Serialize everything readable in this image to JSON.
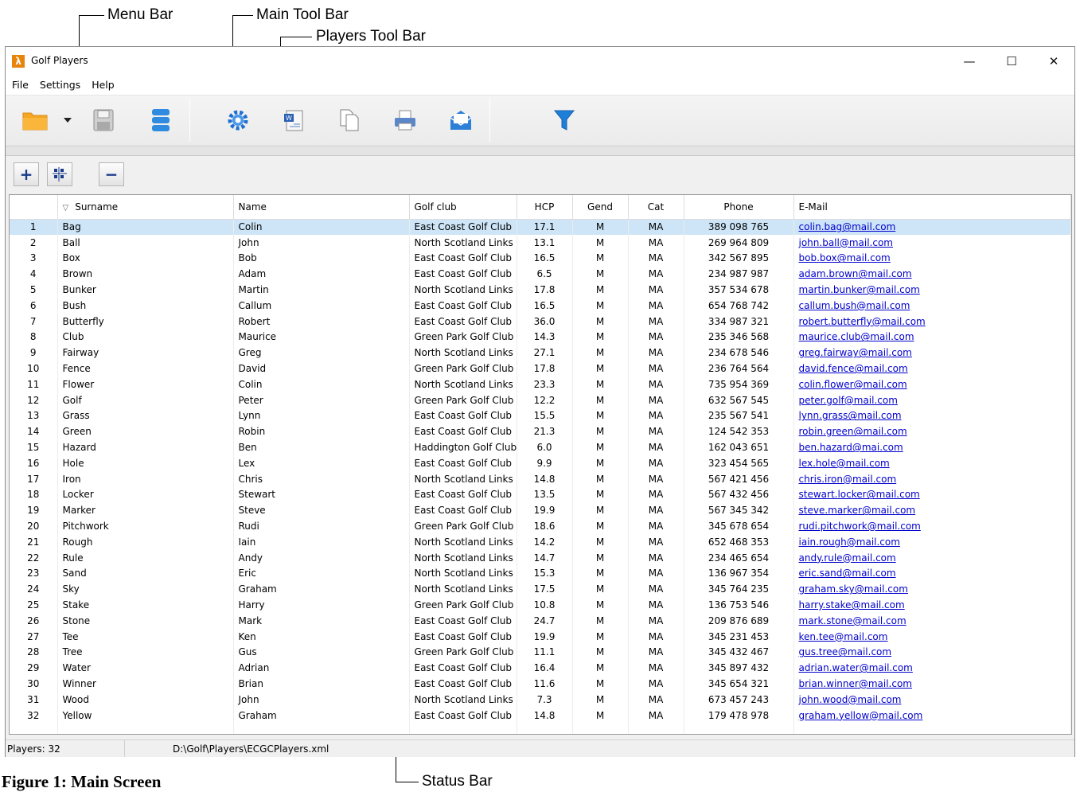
{
  "annotations": {
    "menu_bar": "Menu Bar",
    "main_tool_bar": "Main Tool Bar",
    "players_tool_bar": "Players Tool Bar",
    "status_bar": "Status Bar",
    "figure_caption": "Figure 1: Main Screen"
  },
  "window": {
    "title": "Golf Players",
    "app_icon_glyph": "λ",
    "controls": {
      "minimize": "—",
      "maximize": "☐",
      "close": "✕"
    }
  },
  "menu": [
    "File",
    "Settings",
    "Help"
  ],
  "main_toolbar": {
    "icons": [
      "open-folder-icon",
      "dropdown-arrow-icon",
      "save-icon",
      "database-icon",
      "settings-gear-icon",
      "word-export-icon",
      "copy-icon",
      "print-icon",
      "email-icon",
      "filter-icon"
    ],
    "colors": {
      "folder": "#f5a623",
      "database": "#2f8be0",
      "gear": "#1e6fd0",
      "filter": "#1e7fd8"
    }
  },
  "players_toolbar": {
    "add": "+",
    "remove": "−"
  },
  "table": {
    "columns": [
      "",
      "Surname",
      "Name",
      "Golf club",
      "HCP",
      "Gend",
      "Cat",
      "Phone",
      "E-Mail"
    ],
    "selected_row": 0,
    "rows": [
      [
        "1",
        "Bag",
        "Colin",
        "East Coast Golf Club",
        "17.1",
        "M",
        "MA",
        "389 098 765",
        "colin.bag@mail.com"
      ],
      [
        "2",
        "Ball",
        "John",
        "North Scotland Links",
        "13.1",
        "M",
        "MA",
        "269 964 809",
        "john.ball@mail.com"
      ],
      [
        "3",
        "Box",
        "Bob",
        "East Coast Golf Club",
        "16.5",
        "M",
        "MA",
        "342 567 895",
        "bob.box@mail.com"
      ],
      [
        "4",
        "Brown",
        "Adam",
        "East Coast Golf Club",
        "6.5",
        "M",
        "MA",
        "234 987 987",
        "adam.brown@mail.com"
      ],
      [
        "5",
        "Bunker",
        "Martin",
        "North Scotland Links",
        "17.8",
        "M",
        "MA",
        "357 534 678",
        "martin.bunker@mail.com"
      ],
      [
        "6",
        "Bush",
        "Callum",
        "East Coast Golf Club",
        "16.5",
        "M",
        "MA",
        "654 768 742",
        "callum.bush@mail.com"
      ],
      [
        "7",
        "Butterfly",
        "Robert",
        "East Coast Golf Club",
        "36.0",
        "M",
        "MA",
        "334 987 321",
        "robert.butterfly@mail.com"
      ],
      [
        "8",
        "Club",
        "Maurice",
        "Green Park Golf Club",
        "14.3",
        "M",
        "MA",
        "235 346 568",
        "maurice.club@mail.com"
      ],
      [
        "9",
        "Fairway",
        "Greg",
        "North Scotland Links",
        "27.1",
        "M",
        "MA",
        "234 678 546",
        "greg.fairway@mail.com"
      ],
      [
        "10",
        "Fence",
        "David",
        "Green Park Golf Club",
        "17.8",
        "M",
        "MA",
        "236 764 564",
        "david.fence@mail.com"
      ],
      [
        "11",
        "Flower",
        "Colin",
        "North Scotland Links",
        "23.3",
        "M",
        "MA",
        "735 954 369",
        "colin.flower@mail.com"
      ],
      [
        "12",
        "Golf",
        "Peter",
        "Green Park Golf Club",
        "12.2",
        "M",
        "MA",
        "632 567 545",
        "peter.golf@mail.com"
      ],
      [
        "13",
        "Grass",
        "Lynn",
        "East Coast Golf Club",
        "15.5",
        "M",
        "MA",
        "235 567 541",
        "lynn.grass@mail.com"
      ],
      [
        "14",
        "Green",
        "Robin",
        "East Coast Golf Club",
        "21.3",
        "M",
        "MA",
        "124 542 353",
        "robin.green@mail.com"
      ],
      [
        "15",
        "Hazard",
        "Ben",
        "Haddington Golf Club",
        "6.0",
        "M",
        "MA",
        "162 043 651",
        "ben.hazard@mai.com"
      ],
      [
        "16",
        "Hole",
        "Lex",
        "East Coast Golf Club",
        "9.9",
        "M",
        "MA",
        "323 454 565",
        "lex.hole@mail.com"
      ],
      [
        "17",
        "Iron",
        "Chris",
        "North Scotland Links",
        "14.8",
        "M",
        "MA",
        "567 421 456",
        "chris.iron@mail.com"
      ],
      [
        "18",
        "Locker",
        "Stewart",
        "East Coast Golf Club",
        "13.5",
        "M",
        "MA",
        "567 432 456",
        "stewart.locker@mail.com"
      ],
      [
        "19",
        "Marker",
        "Steve",
        "East Coast Golf Club",
        "19.9",
        "M",
        "MA",
        "567 345 342",
        "steve.marker@mail.com"
      ],
      [
        "20",
        "Pitchwork",
        "Rudi",
        "Green Park Golf Club",
        "18.6",
        "M",
        "MA",
        "345 678 654",
        "rudi.pitchwork@mail.com"
      ],
      [
        "21",
        "Rough",
        "Iain",
        "North Scotland Links",
        "14.2",
        "M",
        "MA",
        "652 468 353",
        "iain.rough@mail.com"
      ],
      [
        "22",
        "Rule",
        "Andy",
        "North Scotland Links",
        "14.7",
        "M",
        "MA",
        "234 465 654",
        "andy.rule@mail.com"
      ],
      [
        "23",
        "Sand",
        "Eric",
        "North Scotland Links",
        "15.3",
        "M",
        "MA",
        "136 967 354",
        "eric.sand@mail.com"
      ],
      [
        "24",
        "Sky",
        "Graham",
        "North Scotland Links",
        "17.5",
        "M",
        "MA",
        "345 764 235",
        "graham.sky@mail.com"
      ],
      [
        "25",
        "Stake",
        "Harry",
        "Green Park Golf Club",
        "10.8",
        "M",
        "MA",
        "136 753 546",
        "harry.stake@mail.com"
      ],
      [
        "26",
        "Stone",
        "Mark",
        "East Coast Golf Club",
        "24.7",
        "M",
        "MA",
        "209 876 689",
        "mark.stone@mail.com"
      ],
      [
        "27",
        "Tee",
        "Ken",
        "East Coast Golf Club",
        "19.9",
        "M",
        "MA",
        "345 231 453",
        "ken.tee@mail.com"
      ],
      [
        "28",
        "Tree",
        "Gus",
        "Green Park Golf Club",
        "11.1",
        "M",
        "MA",
        "345 432 467",
        "gus.tree@mail.com"
      ],
      [
        "29",
        "Water",
        "Adrian",
        "East Coast Golf Club",
        "16.4",
        "M",
        "MA",
        "345 897 432",
        "adrian.water@mail.com"
      ],
      [
        "30",
        "Winner",
        "Brian",
        "East Coast Golf Club",
        "11.6",
        "M",
        "MA",
        "345 654 321",
        "brian.winner@mail.com"
      ],
      [
        "31",
        "Wood",
        "John",
        "North Scotland Links",
        "7.3",
        "M",
        "MA",
        "673 457 243",
        "john.wood@mail.com"
      ],
      [
        "32",
        "Yellow",
        "Graham",
        "East Coast Golf Club",
        "14.8",
        "M",
        "MA",
        "179 478 978",
        "graham.yellow@mail.com"
      ]
    ]
  },
  "status": {
    "count": "Players: 32",
    "file_path": "D:\\Golf\\Players\\ECGCPlayers.xml"
  }
}
